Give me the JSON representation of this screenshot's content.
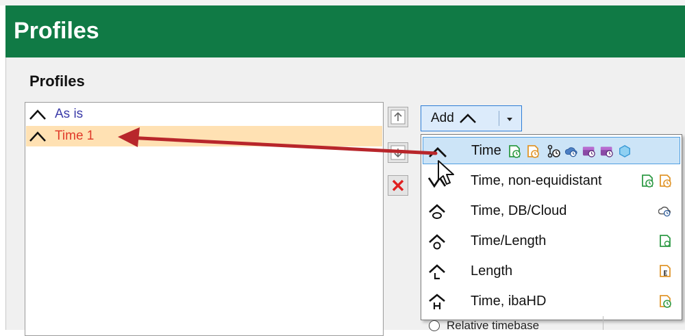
{
  "window": {
    "title": "Profiles"
  },
  "section": {
    "label": "Profiles"
  },
  "profiles": [
    {
      "label": "As is",
      "color": "#3a3aa8"
    },
    {
      "label": "Time 1",
      "color": "#e03a2a"
    }
  ],
  "add_button": {
    "label": "Add"
  },
  "menu": [
    {
      "label": "Time",
      "icon": "time-profile-icon"
    },
    {
      "label": "Time, non-equidistant",
      "icon": "non-equidistant-profile-icon"
    },
    {
      "label": "Time, DB/Cloud",
      "icon": "db-cloud-profile-icon"
    },
    {
      "label": "Time/Length",
      "icon": "time-length-profile-icon"
    },
    {
      "label": "Length",
      "icon": "length-profile-icon"
    },
    {
      "label": "Time, ibaHD",
      "icon": "ibahd-profile-icon"
    }
  ],
  "timebase": {
    "relative_label": "Relative timebase"
  },
  "colors": {
    "title_bar": "#107a45",
    "selection": "#ffe1b3",
    "highlight": "#cce4f7",
    "arrow": "#b8262b"
  }
}
